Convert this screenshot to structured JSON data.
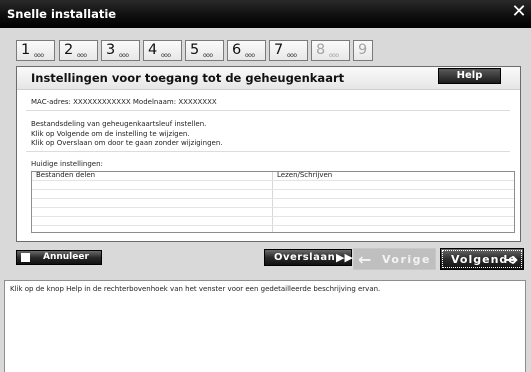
{
  "window": {
    "title": "Snelle installatie",
    "close_glyph": "✕"
  },
  "steps": [
    {
      "num": "1",
      "active": true
    },
    {
      "num": "2",
      "active": true
    },
    {
      "num": "3",
      "active": true
    },
    {
      "num": "4",
      "active": true
    },
    {
      "num": "5",
      "active": true
    },
    {
      "num": "6",
      "active": true
    },
    {
      "num": "7",
      "active": true
    },
    {
      "num": "8",
      "active": false
    },
    {
      "num": "9",
      "active": false
    }
  ],
  "step_dots": "ooo",
  "panel": {
    "title": "Instellingen voor toegang tot de geheugenkaart",
    "help_label": "Help",
    "mac_line": "MAC-adres: XXXXXXXXXXXX  Modelnaam: XXXXXXXX",
    "description": [
      "Bestandsdeling van geheugenkaartsleuf instellen.",
      "Klik op Volgende om de instelling te wijzigen.",
      "Klik op Overslaan om door te gaan zonder wijzigingen."
    ],
    "current_label": "Huidige instellingen:",
    "settings_rows": [
      {
        "name": "Bestanden delen",
        "value": "Lezen/Schrijven"
      },
      {
        "name": "",
        "value": ""
      },
      {
        "name": "",
        "value": ""
      },
      {
        "name": "",
        "value": ""
      },
      {
        "name": "",
        "value": ""
      },
      {
        "name": "",
        "value": ""
      }
    ]
  },
  "buttons": {
    "cancel": "Annuleer",
    "skip": "Overslaan",
    "skip_icon": "▶▶|",
    "prev": "Vorige",
    "prev_icon": "←",
    "next": "Volgende",
    "next_icon": "➔"
  },
  "info_text": "Klik op de knop Help in de rechterbovenhoek van het venster voor een gedetailleerde beschrijving ervan.",
  "colors": {
    "titlebar": "#000000",
    "background": "#d9d9d9",
    "disabled_button": "#bfbfbf"
  }
}
